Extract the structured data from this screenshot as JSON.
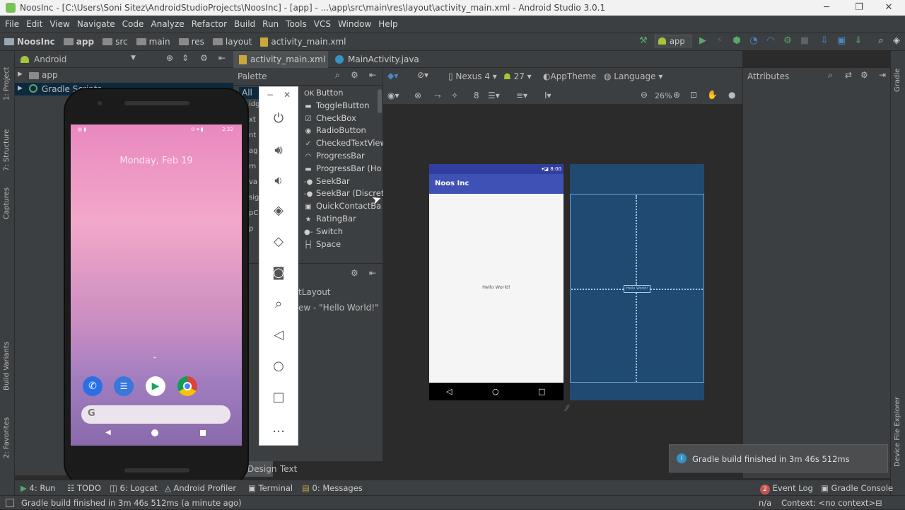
{
  "window": {
    "title": "NoosInc - [C:\\Users\\Soni Sitez\\AndroidStudioProjects\\NoosInc] - [app] - ...\\app\\src\\main\\res\\layout\\activity_main.xml - Android Studio 3.0.1"
  },
  "menu": [
    "File",
    "Edit",
    "View",
    "Navigate",
    "Code",
    "Analyze",
    "Refactor",
    "Build",
    "Run",
    "Tools",
    "VCS",
    "Window",
    "Help"
  ],
  "breadcrumb": [
    "NoosInc",
    "app",
    "src",
    "main",
    "res",
    "layout",
    "activity_main.xml"
  ],
  "toolbar": {
    "run_config": "app"
  },
  "project": {
    "view_mode": "Android",
    "items": [
      "app",
      "Gradle Scripts"
    ]
  },
  "editor_tabs": [
    "activity_main.xml",
    "MainActivity.java"
  ],
  "palette": {
    "title": "Palette",
    "categories": [
      "All",
      "idg",
      "xt",
      "nt",
      "ag",
      "rn",
      "va",
      "sig",
      "pC",
      "p"
    ],
    "items": [
      "Button",
      "ToggleButton",
      "CheckBox",
      "RadioButton",
      "CheckedTextView",
      "ProgressBar",
      "ProgressBar (Ho",
      "SeekBar",
      "SeekBar (Discret",
      "QuickContactBa",
      "RatingBar",
      "Switch",
      "Space"
    ],
    "icons": [
      "ok-icon",
      "toggle-icon",
      "checkbox-icon",
      "radio-icon",
      "checked-text-icon",
      "progress-circle-icon",
      "progress-bar-icon",
      "seekbar-icon",
      "seekbar-discrete-icon",
      "contact-icon",
      "star-icon",
      "switch-icon",
      "space-icon"
    ]
  },
  "component_tree": {
    "root": "tLayout",
    "child": "ew - \"Hello World!\""
  },
  "design_toolbar": {
    "device": "Nexus 4",
    "api": "27",
    "theme": "AppTheme",
    "language": "Language",
    "zoom": "26%",
    "margin": "8"
  },
  "preview": {
    "status_time": "8:00",
    "app_title": "Noos Inc",
    "content_text": "Hello World!",
    "blueprint_text": "Hello World!"
  },
  "design_tabs": [
    "Design",
    "Text"
  ],
  "attributes": {
    "title": "Attributes"
  },
  "phone": {
    "date": "Monday, Feb 19",
    "time": "2:32",
    "search_glyph": "G"
  },
  "bottom_tabs": {
    "run": "4: Run",
    "todo": "TODO",
    "logcat": "6: Logcat",
    "profiler": "Android Profiler",
    "terminal": "Terminal",
    "messages": "0: Messages",
    "event_log": "Event Log",
    "event_count": "2",
    "gradle_console": "Gradle Console"
  },
  "side_tabs": {
    "project": "1: Project",
    "structure": "7: Structure",
    "captures": "Captures",
    "build_variants": "Build Variants",
    "favorites": "2: Favorites",
    "gradle": "Gradle",
    "device_explorer": "Device File Explorer"
  },
  "toast": {
    "message": "Gradle build finished in 3m 46s 512ms"
  },
  "status": {
    "message": "Gradle build finished in 3m 46s 512ms (a minute ago)",
    "na": "n/a",
    "context": "Context: <no context>"
  },
  "colors": {
    "accent": "#3f51b5",
    "blueprint": "#214a72",
    "run_green": "#59a869"
  }
}
